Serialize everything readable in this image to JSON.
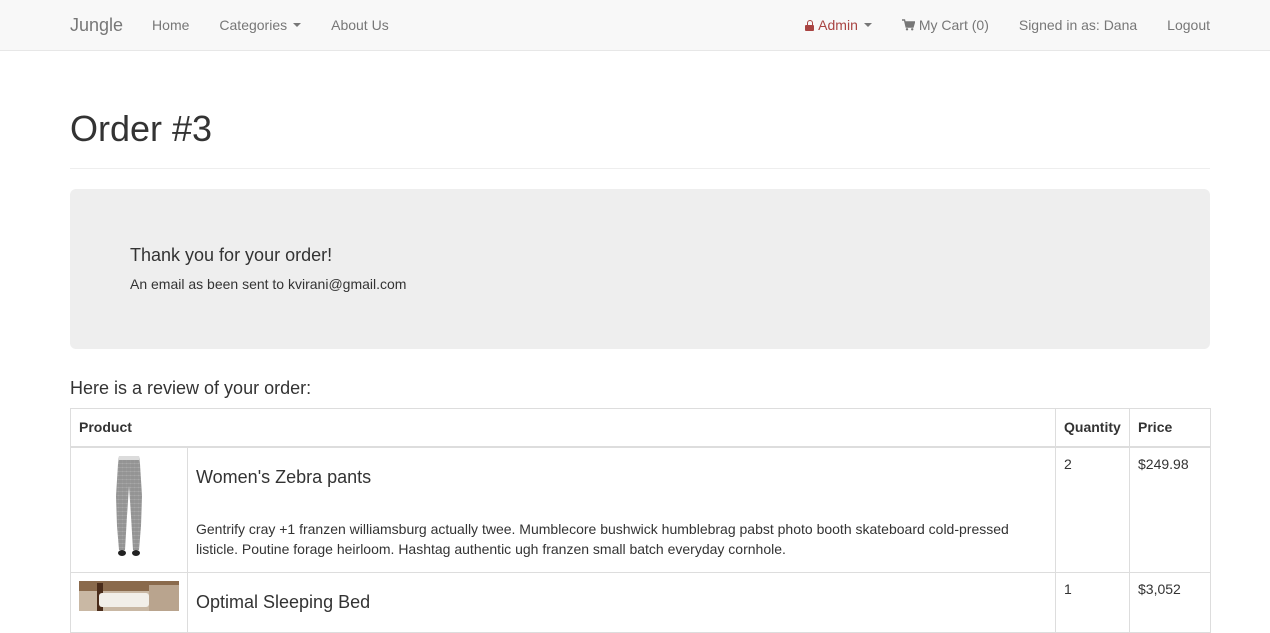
{
  "navbar": {
    "brand": "Jungle",
    "links": {
      "home": "Home",
      "categories": "Categories",
      "about": "About Us",
      "admin": "Admin",
      "cart": "My Cart (0)",
      "signed_in": "Signed in as: Dana",
      "logout": "Logout"
    },
    "admin_color": "#a94442"
  },
  "page": {
    "title": "Order #3"
  },
  "confirmation": {
    "title": "Thank you for your order!",
    "message": "An email as been sent to kvirani@gmail.com"
  },
  "review": {
    "heading": "Here is a review of your order:",
    "columns": {
      "product": "Product",
      "quantity": "Quantity",
      "price": "Price"
    },
    "items": [
      {
        "name": "Women's Zebra pants",
        "description": "Gentrify cray +1 franzen williamsburg actually twee. Mumblecore bushwick humblebrag pabst photo booth skateboard cold-pressed listicle. Poutine forage heirloom. Hashtag authentic ugh franzen small batch everyday cornhole.",
        "quantity": "2",
        "price": "$249.98"
      },
      {
        "name": "Optimal Sleeping Bed",
        "description": "",
        "quantity": "1",
        "price": "$3,052"
      }
    ]
  }
}
